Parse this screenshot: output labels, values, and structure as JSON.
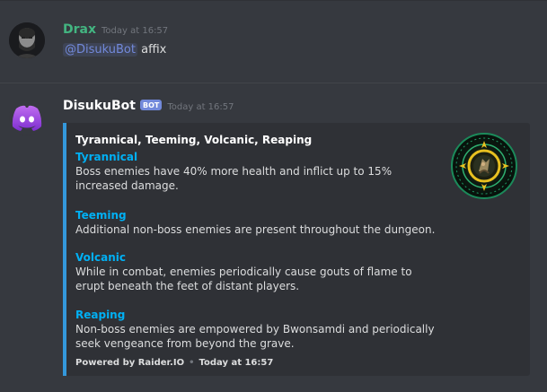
{
  "messages": [
    {
      "author": "Drax",
      "timestamp": "Today at 16:57",
      "mention": "@DisukuBot",
      "text": "affix",
      "author_color": "#43b581"
    },
    {
      "author": "DisukuBot",
      "bot_tag": "BOT",
      "timestamp": "Today at 16:57",
      "embed": {
        "accent_color": "#3498db",
        "title": "Tyrannical, Teeming, Volcanic, Reaping",
        "fields": [
          {
            "name": "Tyrannical",
            "value": "Boss enemies have 40% more health and inflict up to 15% increased damage."
          },
          {
            "name": "Teeming",
            "value": "Additional non-boss enemies are present throughout the dungeon."
          },
          {
            "name": "Volcanic",
            "value": "While in combat, enemies periodically cause gouts of flame to erupt beneath the feet of distant players."
          },
          {
            "name": "Reaping",
            "value": "Non-boss enemies are empowered by Bwonsamdi and periodically seek vengeance from beyond the grave."
          }
        ],
        "footer_text": "Powered by Raider.IO",
        "footer_separator": "•",
        "footer_timestamp": "Today at 16:57",
        "thumbnail_icon": "mythic-keystone-icon"
      }
    }
  ],
  "colors": {
    "background": "#36393f",
    "embed_background": "#2f3136",
    "field_name": "#00b0f4",
    "bot_tag": "#7289da",
    "mention": "#7289da"
  }
}
